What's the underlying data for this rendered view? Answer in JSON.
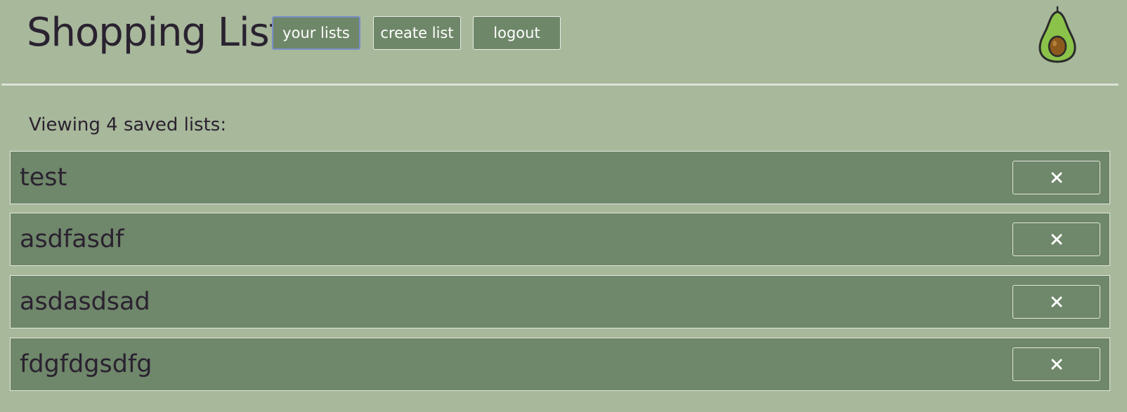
{
  "header": {
    "title": "Shopping List",
    "nav": {
      "your_lists": "your lists",
      "create_list": "create list",
      "logout": "logout"
    },
    "logo_icon": "avocado-icon"
  },
  "summary": "Viewing 4 saved lists:",
  "lists": [
    {
      "name": "test",
      "delete_icon": "close-icon"
    },
    {
      "name": "asdfasdf",
      "delete_icon": "close-icon"
    },
    {
      "name": "asdasdsad",
      "delete_icon": "close-icon"
    },
    {
      "name": "fdgfdgsdfg",
      "delete_icon": "close-icon"
    }
  ],
  "colors": {
    "background": "#a8b89b",
    "accent_green": "#6f876a",
    "text_dark": "#2a2230",
    "active_border": "#7a8fc7"
  }
}
